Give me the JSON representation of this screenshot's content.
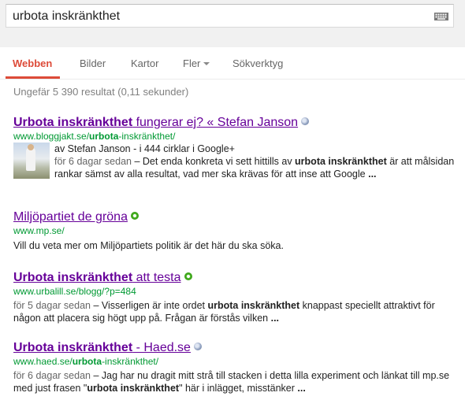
{
  "search": {
    "query": "urbota inskränkthet"
  },
  "tabs": [
    {
      "label": "Webben",
      "active": true
    },
    {
      "label": "Bilder"
    },
    {
      "label": "Kartor"
    },
    {
      "label": "Fler",
      "dropdown": true
    },
    {
      "label": "Sökverktyg"
    }
  ],
  "stats": "Ungefär 5 390 resultat (0,11 sekunder)",
  "results": [
    {
      "title_bold": "Urbota inskränkthet",
      "title_rest": " fungerar ej? « Stefan Janson",
      "url_pre": "www.bloggjakt.se/",
      "url_bold": "urbota",
      "url_post": "-inskränkthet/",
      "author": "av Stefan Janson - i 444 cirklar i Google+",
      "date": "för 6 dagar sedan",
      "snip_a": " – Det enda konkreta vi sett hittills av ",
      "snip_b": "urbota inskränkthet",
      "snip_c": " är att målsidan rankar sämst av alla resultat, vad mer ska krävas för att inse att Google ",
      "snip_ell": "..."
    },
    {
      "title": "Miljöpartiet de gröna",
      "url": "www.mp.se/",
      "snippet": "Vill du veta mer om Miljöpartiets politik är det här du ska söka."
    },
    {
      "title_bold": "Urbota inskränkthet",
      "title_rest": " att testa",
      "url": "www.urbalill.se/blogg/?p=484",
      "date": "för 5 dagar sedan",
      "snip_a": " – Visserligen är inte ordet ",
      "snip_b": "urbota inskränkthet",
      "snip_c": " knappast speciellt attraktivt för någon att placera sig högt upp på. Frågan är förstås vilken ",
      "snip_ell": "..."
    },
    {
      "title_bold": "Urbota inskränkthet",
      "title_rest": " - Haed.se",
      "url_pre": "www.haed.se/",
      "url_bold": "urbota",
      "url_post": "-inskränkthet/",
      "date": "för 6 dagar sedan",
      "snip_a": " – Jag har nu dragit mitt strå till stacken i detta lilla experiment och länkat till mp.se med just frasen \"",
      "snip_b": "urbota inskränkthet",
      "snip_c": "\" här i inlägget, misstänker ",
      "snip_ell": "..."
    }
  ]
}
